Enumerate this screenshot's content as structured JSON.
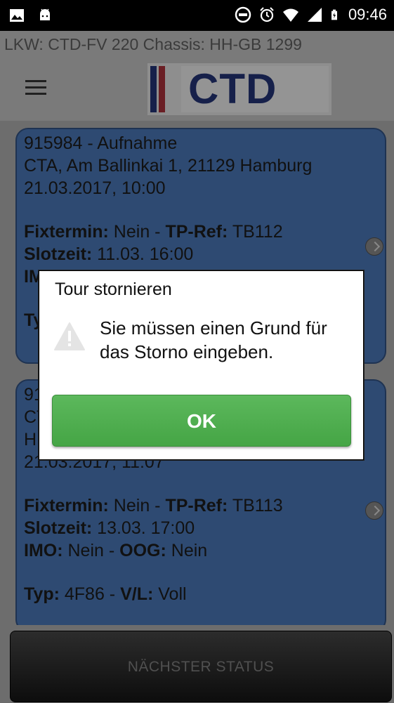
{
  "status_bar": {
    "time": "09:46",
    "icons": [
      "image-icon",
      "android-icon",
      "do-not-disturb-icon",
      "alarm-icon",
      "wifi-icon",
      "signal-icon",
      "battery-charging-icon"
    ]
  },
  "header": {
    "subtitle": "LKW: CTD-FV 220  Chassis: HH-GB 1299",
    "logo_text": "CTD",
    "menu_icon": "hamburger-menu-icon"
  },
  "cards": [
    {
      "line1": "915984 - Aufnahme",
      "line2": "CTA, Am Ballinkai 1, 21129 Hamburg",
      "line3": "21.03.2017, 10:00",
      "fixtermin_label": "Fixtermin:",
      "fixtermin_value": " Nein - ",
      "tpref_label": "TP-Ref:",
      "tpref_value": " TB112",
      "slotzeit_label": "Slotzeit:",
      "slotzeit_value": " 11.03. 16:00",
      "imo_label": "IMO:",
      "typ_label": "Ty"
    },
    {
      "line1": "91",
      "line2": "CT",
      "line3": "H",
      "line4": "21.03.2017, 11:07",
      "fixtermin_label": "Fixtermin:",
      "fixtermin_value": " Nein - ",
      "tpref_label": "TP-Ref:",
      "tpref_value": " TB113",
      "slotzeit_label": "Slotzeit:",
      "slotzeit_value": " 13.03. 17:00",
      "imo_label": "IMO:",
      "imo_value": " Nein - ",
      "oog_label": "OOG:",
      "oog_value": " Nein",
      "typ_label": "Typ:",
      "typ_value": " 4F86 - ",
      "vl_label": "V/L:",
      "vl_value": " Voll"
    }
  ],
  "bottom_button": {
    "label": "NÄCHSTER STATUS"
  },
  "dialog": {
    "title": "Tour stornieren",
    "message": "Sie müssen einen Grund für das Storno eingeben.",
    "icon": "warning-icon",
    "ok_label": "OK"
  }
}
